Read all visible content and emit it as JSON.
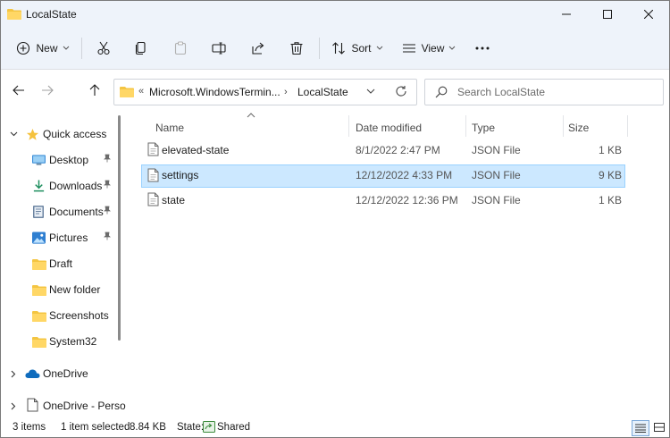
{
  "window": {
    "title": "LocalState"
  },
  "toolbar": {
    "new_label": "New",
    "sort_label": "Sort",
    "view_label": "View"
  },
  "address": {
    "overflow": "«",
    "segments": [
      "Microsoft.WindowsTermin...",
      "LocalState"
    ],
    "separator": "›"
  },
  "search": {
    "placeholder": "Search LocalState"
  },
  "sidebar": {
    "quick_access": "Quick access",
    "items": [
      {
        "label": "Desktop",
        "icon": "desktop-icon",
        "pinned": true
      },
      {
        "label": "Downloads",
        "icon": "download-icon",
        "pinned": true
      },
      {
        "label": "Documents",
        "icon": "documents-icon",
        "pinned": true
      },
      {
        "label": "Pictures",
        "icon": "pictures-icon",
        "pinned": true
      },
      {
        "label": "Draft",
        "icon": "folder-icon",
        "pinned": false
      },
      {
        "label": "New folder",
        "icon": "folder-icon",
        "pinned": false
      },
      {
        "label": "Screenshots",
        "icon": "folder-icon",
        "pinned": false
      },
      {
        "label": "System32",
        "icon": "folder-icon",
        "pinned": false
      }
    ],
    "onedrive": "OneDrive",
    "onedrive_personal": "OneDrive - Perso"
  },
  "columns": {
    "name": "Name",
    "date": "Date modified",
    "type": "Type",
    "size": "Size"
  },
  "files": [
    {
      "name": "elevated-state",
      "date": "8/1/2022 2:47 PM",
      "type": "JSON File",
      "size": "1 KB",
      "selected": false
    },
    {
      "name": "settings",
      "date": "12/12/2022 4:33 PM",
      "type": "JSON File",
      "size": "9 KB",
      "selected": true
    },
    {
      "name": "state",
      "date": "12/12/2022 12:36 PM",
      "type": "JSON File",
      "size": "1 KB",
      "selected": false
    }
  ],
  "status": {
    "items": "3 items",
    "selected": "1 item selected",
    "size": "8.84 KB",
    "state_label": "State:",
    "state_value": "Shared"
  },
  "colors": {
    "accent": "#0067c0",
    "folder": "#f4c542",
    "selection": "#cce8ff"
  }
}
